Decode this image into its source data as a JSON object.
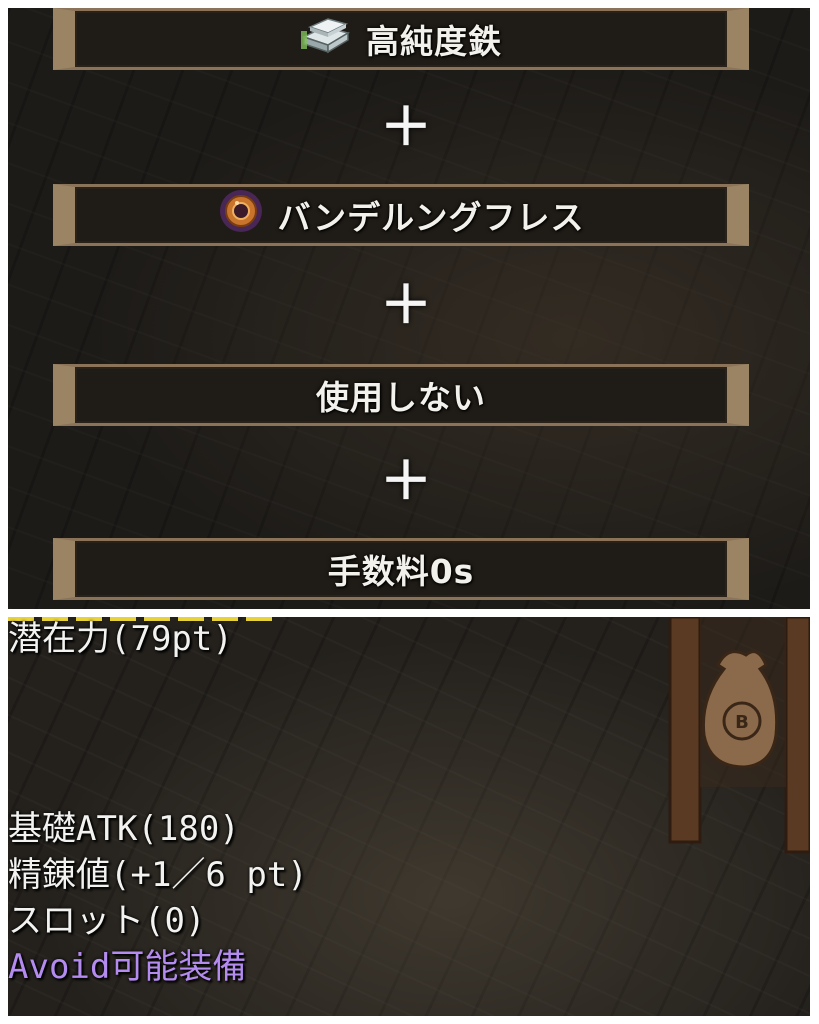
{
  "crafting": {
    "slots": [
      {
        "label": "高純度鉄",
        "icon": "iron-ingot-icon"
      },
      {
        "label": "バンデルングフレス",
        "icon": "orange-ring-icon"
      },
      {
        "label": "使用しない",
        "icon": null
      },
      {
        "label": "手数料0s",
        "icon": null
      }
    ],
    "plus_symbol": "＋"
  },
  "item_stats": {
    "potential": "潜在力(79pt)",
    "base_atk": "基礎ATK(180)",
    "refine": "精錬値(+1／6 pt)",
    "slots": "スロット(0)",
    "avoid": "Avoid可能装備"
  },
  "colors": {
    "avoid_text": "#b48cf0",
    "frame": "#9a8464",
    "slot_bg": "#1f1b16"
  }
}
